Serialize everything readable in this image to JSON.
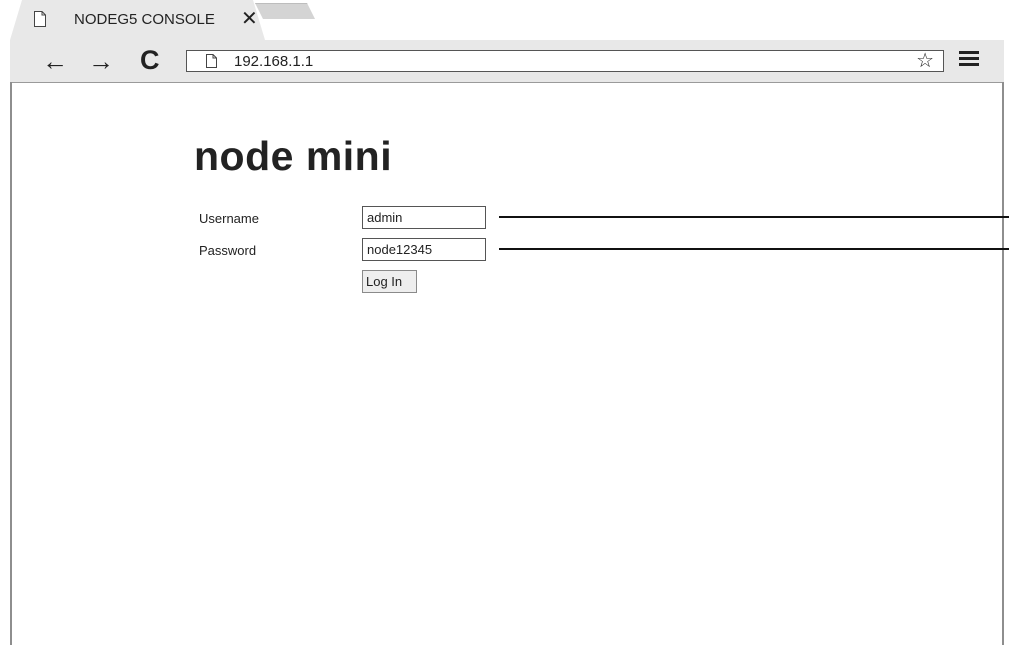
{
  "browser": {
    "tab": {
      "title": "NODEG5 CONSOLE",
      "close_glyph": "✕",
      "icon": "page-icon"
    },
    "toolbar": {
      "back_glyph": "←",
      "forward_glyph": "→",
      "reload_glyph": "C",
      "url": "192.168.1.1",
      "bookmark_glyph": "☆",
      "menu_icon": "hamburger-menu-icon"
    }
  },
  "page": {
    "title": "node mini",
    "form": {
      "username_label": "Username",
      "username_value": "admin",
      "password_label": "Password",
      "password_value": "node12345",
      "submit_label": "Log In"
    }
  },
  "colors": {
    "chrome_background": "#e8e8e8",
    "text": "#222222",
    "page_background": "#ffffff"
  }
}
